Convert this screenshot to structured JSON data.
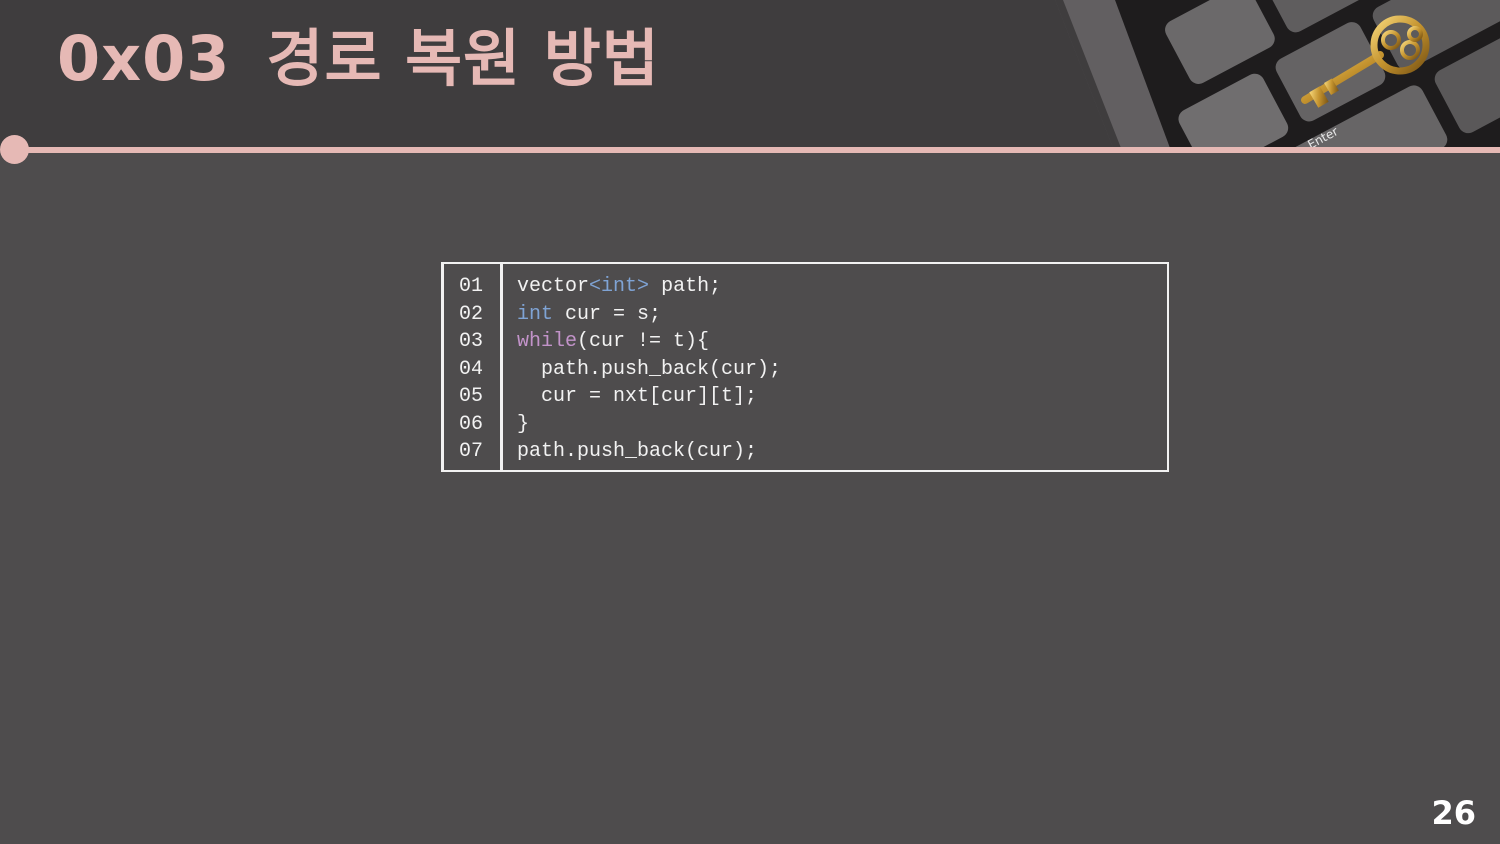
{
  "slide": {
    "title_number": "0x03",
    "title_text": "경로 복원 방법",
    "page_number": "26"
  },
  "header_image": {
    "icon": "key-on-keyboard-icon",
    "key_label": "Enter"
  },
  "code": {
    "line_numbers": [
      "01",
      "02",
      "03",
      "04",
      "05",
      "06",
      "07"
    ],
    "lines": [
      "vector<int> path;",
      "int cur = s;",
      "while(cur != t){",
      "  path.push_back(cur);",
      "  cur = nxt[cur][t];",
      "}",
      "path.push_back(cur);"
    ],
    "tokens": {
      "l1_a": "vector",
      "l1_b": "<",
      "l1_c": "int",
      "l1_d": ">",
      "l1_e": " path;",
      "l2_a": "int",
      "l2_b": " cur = s;",
      "l3_a": "while",
      "l3_b": "(cur != t){"
    }
  },
  "colors": {
    "accent": "#e6b9b5",
    "background": "#4e4c4d",
    "header": "#3f3d3e",
    "keyword_type": "#7fa3d4",
    "keyword_control": "#c293c9"
  }
}
